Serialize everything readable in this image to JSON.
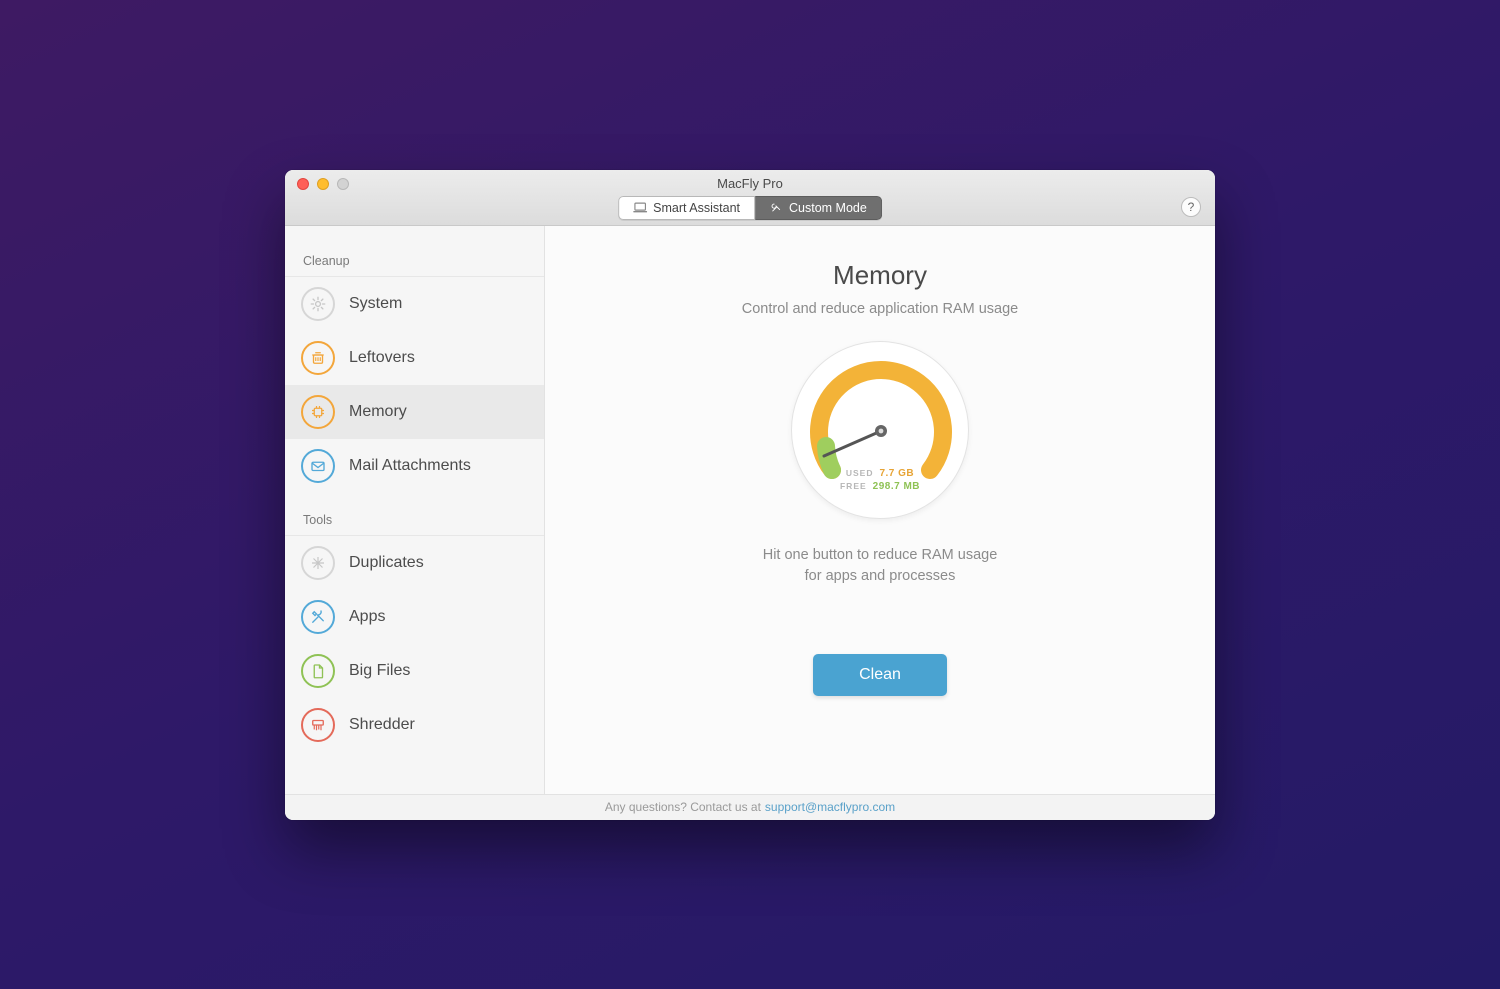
{
  "window": {
    "title": "MacFly Pro"
  },
  "toolbar": {
    "smart_label": "Smart Assistant",
    "custom_label": "Custom Mode",
    "active": "custom",
    "help": "?"
  },
  "sidebar": {
    "groups": [
      {
        "label": "Cleanup",
        "items": [
          {
            "id": "system",
            "label": "System",
            "icon": "gear-icon",
            "ring": "gray"
          },
          {
            "id": "leftovers",
            "label": "Leftovers",
            "icon": "trash-icon",
            "ring": "orange"
          },
          {
            "id": "memory",
            "label": "Memory",
            "icon": "chip-icon",
            "ring": "orange",
            "selected": true
          },
          {
            "id": "mail",
            "label": "Mail Attachments",
            "icon": "envelope-icon",
            "ring": "blue"
          }
        ]
      },
      {
        "label": "Tools",
        "items": [
          {
            "id": "duplicates",
            "label": "Duplicates",
            "icon": "snow-icon",
            "ring": "gray"
          },
          {
            "id": "apps",
            "label": "Apps",
            "icon": "tools-icon",
            "ring": "blue"
          },
          {
            "id": "bigfiles",
            "label": "Big Files",
            "icon": "doc-icon",
            "ring": "green"
          },
          {
            "id": "shredder",
            "label": "Shredder",
            "icon": "shredder-icon",
            "ring": "red"
          }
        ]
      }
    ]
  },
  "main": {
    "heading": "Memory",
    "subheading": "Control and reduce application RAM usage",
    "gauge": {
      "used_label": "USED",
      "used_value": "7.7 GB",
      "free_label": "FREE",
      "free_value": "298.7 MB"
    },
    "description_line1": "Hit one button to reduce RAM usage",
    "description_line2": "for apps and processes",
    "cta_label": "Clean"
  },
  "footer": {
    "text": "Any questions? Contact us at ",
    "email": "support@macflypro.com"
  },
  "colors": {
    "accent_blue": "#4aa3d1",
    "gauge_orange": "#f3b338",
    "gauge_green": "#9fce5e"
  }
}
